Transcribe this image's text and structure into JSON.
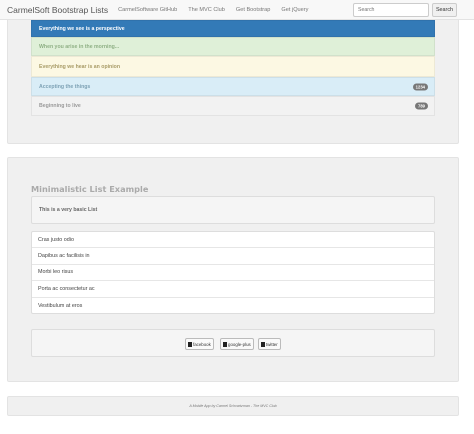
{
  "navbar": {
    "brand": "CarmelSoft Bootstrap Lists",
    "links": [
      "CarmelSoftware GitHub",
      "The MVC Club",
      "Get Bootstrap",
      "Get jQuery"
    ],
    "search_placeholder": "Search",
    "search_button": "Search"
  },
  "top_list": {
    "items": [
      {
        "label": "Everything we see is a perspective",
        "bg": "#337ab7",
        "color": "#ffffff"
      },
      {
        "label": "When you arise in the morning...",
        "bg": "#dff0d8",
        "color": "#8fb085"
      },
      {
        "label": "Everything we hear is an opinion",
        "bg": "#fcf8e3",
        "color": "#a89b67"
      },
      {
        "label": "Accepting the things",
        "badge": "1234",
        "bg": "#d9edf7",
        "color": "#7ea2b5"
      },
      {
        "label": "Beginning to live",
        "badge": "789",
        "bg": "#f2f2f2",
        "color": "#9a9a9a"
      }
    ]
  },
  "main": {
    "heading": "Minimalistic List Example",
    "panel_heading": "This is a very basic List",
    "items": [
      "Cras justo odio",
      "Dapibus ac facilisis in",
      "Morbi leo risus",
      "Porta ac consectetur ac",
      "Vestibulum at eros"
    ]
  },
  "social": {
    "buttons": [
      {
        "label": "facebook",
        "icon": "facebook-icon"
      },
      {
        "label": "google-plus",
        "icon": "google-plus-icon"
      },
      {
        "label": "twitter",
        "icon": "twitter-icon"
      }
    ]
  },
  "footer": {
    "text": "A Mobile App by Carmel Schvartzman - The MVC Club"
  }
}
